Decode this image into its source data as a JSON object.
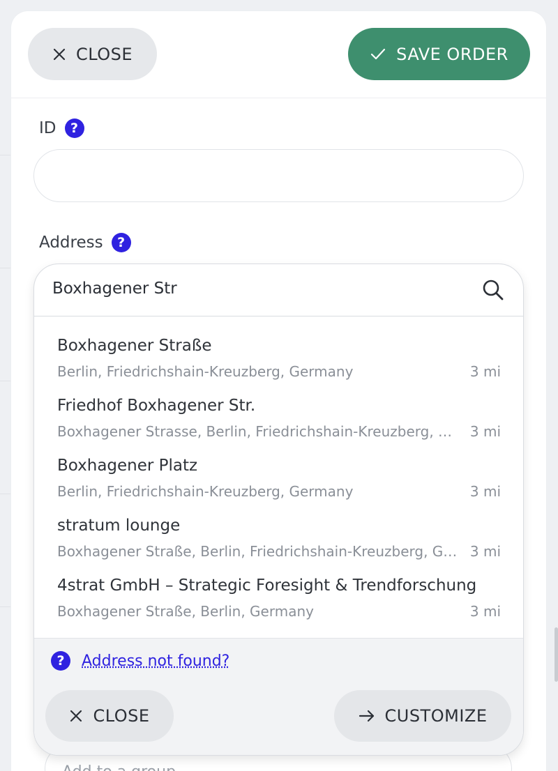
{
  "header": {
    "close_label": "CLOSE",
    "save_label": "SAVE ORDER"
  },
  "form": {
    "id_label": "ID",
    "id_value": "",
    "address_label": "Address",
    "address_value": "Boxhagener Str",
    "group_placeholder": "Add to a group..."
  },
  "suggestions": [
    {
      "name": "Boxhagener Straße",
      "detail": "Berlin, Friedrichshain-Kreuzberg, Germany",
      "distance": "3 mi"
    },
    {
      "name": "Friedhof Boxhagener Str.",
      "detail": "Boxhagener Strasse, Berlin, Friedrichshain-Kreuzberg, Germany",
      "distance": "3 mi"
    },
    {
      "name": "Boxhagener Platz",
      "detail": "Berlin, Friedrichshain-Kreuzberg, Germany",
      "distance": "3 mi"
    },
    {
      "name": "stratum lounge",
      "detail": "Boxhagener Straße, Berlin, Friedrichshain-Kreuzberg, Germany",
      "distance": "3 mi"
    },
    {
      "name": "4strat GmbH – Strategic Foresight & Trendforschung",
      "detail": "Boxhagener Straße, Berlin, Germany",
      "distance": "3 mi"
    }
  ],
  "dropdown_footer": {
    "not_found_label": "Address not found?",
    "close_label": "CLOSE",
    "customize_label": "CUSTOMIZE"
  },
  "icons": {
    "help": "?"
  },
  "colors": {
    "save_button": "#3e8f6e",
    "help_badge": "#2f22e0",
    "link": "#2f22e0"
  }
}
